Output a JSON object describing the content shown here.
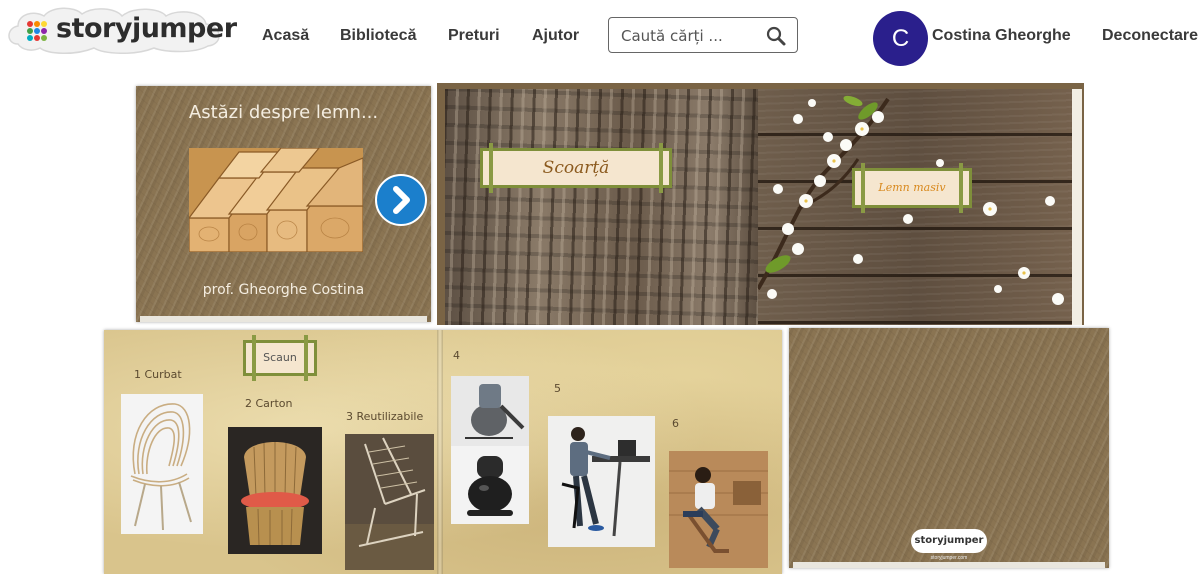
{
  "header": {
    "logo_text": "storyjumper",
    "nav": {
      "home": "Acasă",
      "library": "Bibliotecă",
      "pricing": "Preturi",
      "help": "Ajutor"
    },
    "search": {
      "placeholder": "Caută cărți ..."
    },
    "user": {
      "avatar_letter": "C",
      "name": "Costina Gheorghe"
    },
    "logout": "Deconectare"
  },
  "book": {
    "cover": {
      "title": "Astăzi despre lemn...",
      "author": "prof. Gheorghe Costina"
    },
    "spread1": {
      "left_sign": "Scoarță",
      "right_sign": "Lemn masiv"
    },
    "spread2": {
      "sign": "Scaun",
      "captions": [
        "1 Curbat",
        "2 Carton",
        "3 Reutilizabile",
        "4",
        "5",
        "6"
      ]
    },
    "back_cover": {
      "logo": "storyjumper",
      "url": "storyjumper.com"
    }
  },
  "colors": {
    "avatar": "#2a1f8c",
    "next_button": "#1b7fcc",
    "wood": "#8a7452",
    "parchment": "#d9c48c"
  },
  "icons": [
    "storyjumper-logo-icon",
    "search-icon",
    "chevron-right-icon"
  ]
}
